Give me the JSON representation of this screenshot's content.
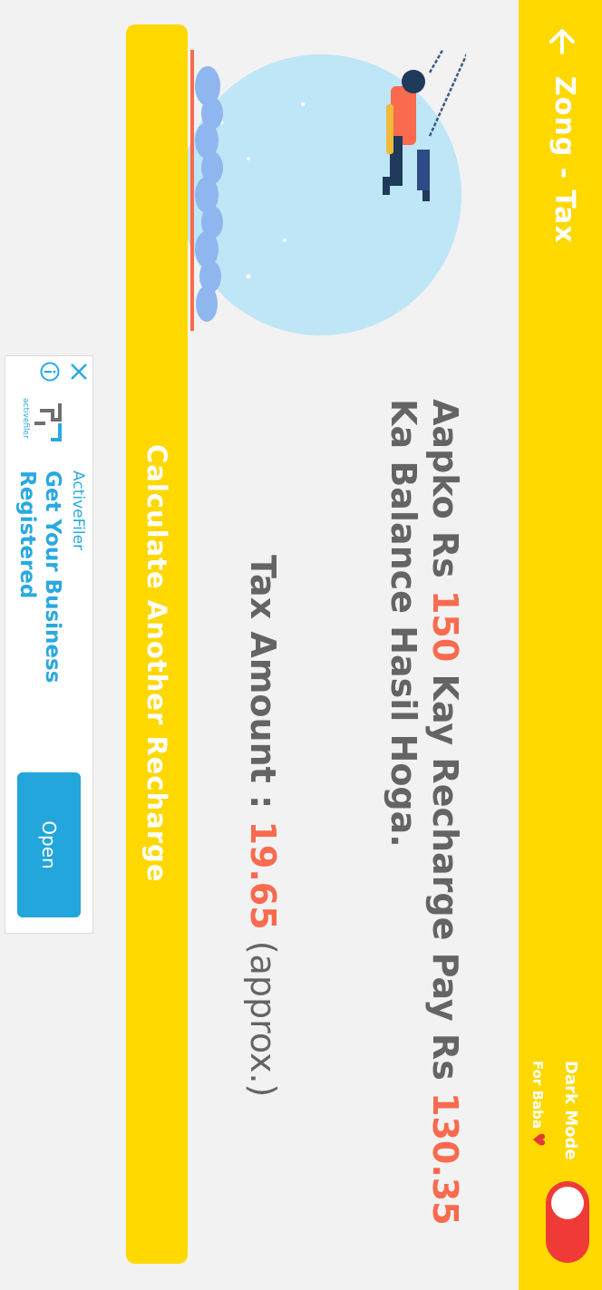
{
  "appbar": {
    "title": "Zong - Tax",
    "dark_mode_label": "Dark Mode",
    "dark_mode_sub": "For Baba",
    "dark_mode_enabled": true
  },
  "message": {
    "part1": "Aapko Rs ",
    "recharge_amount": "150",
    "part2": " Kay Recharge Pay Rs ",
    "balance_amount": "130.35",
    "part3": " Ka Balance Hasil Hoga."
  },
  "tax": {
    "label": "Tax Amount : ",
    "amount": "19.65",
    "suffix": " (approx.)"
  },
  "calculate_button": "Calculate Another Recharge",
  "ad": {
    "brand": "ActiveFiler",
    "headline": "Get Your Business Registered",
    "open_label": "Open",
    "logo_text": "activefiler"
  },
  "colors": {
    "primary": "#ffd800",
    "accent": "#f96a4e",
    "toggle": "#f03a38",
    "ad_blue": "#29a9e0"
  }
}
